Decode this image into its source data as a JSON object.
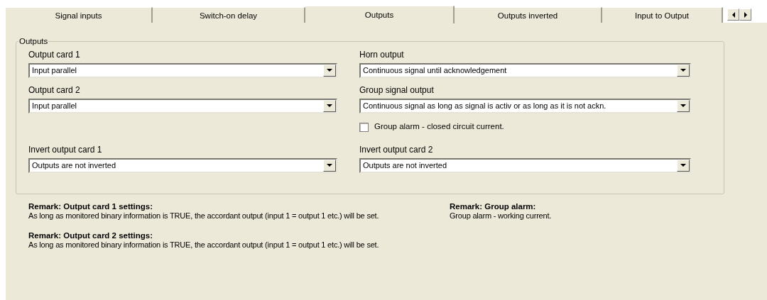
{
  "tabs": [
    {
      "label": "Signal inputs",
      "selected": false
    },
    {
      "label": "Switch-on delay",
      "selected": false
    },
    {
      "label": "Outputs",
      "selected": true
    },
    {
      "label": "Outputs inverted",
      "selected": false
    },
    {
      "label": "Input to Output",
      "selected": false
    }
  ],
  "group": {
    "title": "Outputs",
    "rows": [
      {
        "left": {
          "kind": "select",
          "label": "Output card 1",
          "value": "Input parallel"
        },
        "right": {
          "kind": "select",
          "label": "Horn output",
          "value": "Continuous signal until acknowledgement"
        }
      },
      {
        "left": {
          "kind": "select",
          "label": "Output card 2",
          "value": "Input parallel"
        },
        "right": {
          "kind": "select",
          "label": "Group signal output",
          "value": "Continuous signal as long as signal is activ or as long as it is not ackn."
        }
      },
      {
        "right": {
          "kind": "checkbox",
          "label": "Group alarm - closed circuit current.",
          "checked": false
        }
      },
      {
        "left": {
          "kind": "select",
          "label": "Invert output card 1",
          "value": "Outputs are not inverted"
        },
        "right": {
          "kind": "select",
          "label": "Invert output card 2",
          "value": "Outputs are not inverted"
        }
      }
    ]
  },
  "remarks": {
    "left": [
      {
        "title": "Remark: Output card 1 settings:",
        "text": "As long as monitored binary information is TRUE, the accordant output (input 1 = output 1 etc.) will be set."
      },
      {
        "title": "Remark: Output card 2 settings:",
        "text": "As long as monitored binary information is TRUE, the accordant output (input 1 = output 1 etc.) will be set."
      }
    ],
    "right": [
      {
        "title": "Remark: Group alarm:",
        "text": "Group alarm - working current."
      }
    ]
  }
}
